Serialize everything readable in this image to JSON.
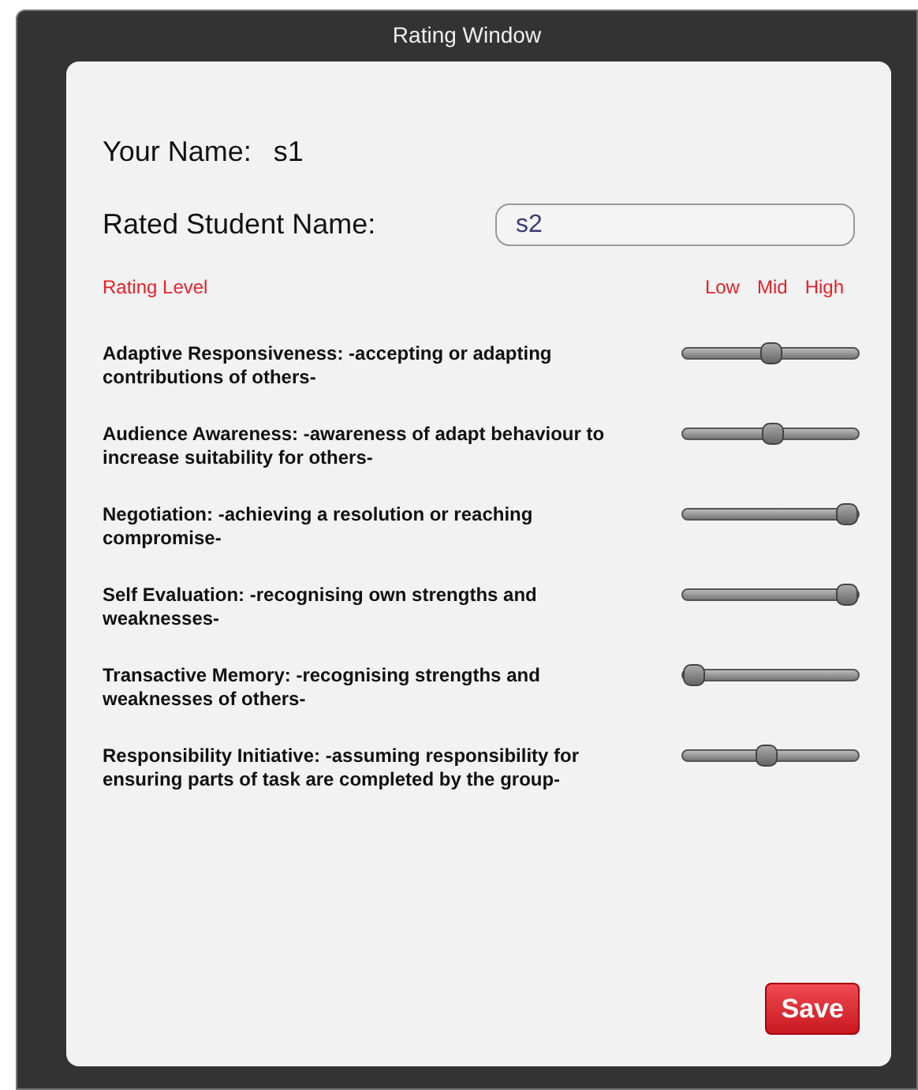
{
  "window": {
    "title": "Rating Window"
  },
  "your_name": {
    "label": "Your Name:",
    "value": "s1"
  },
  "rated_student": {
    "label": "Rated Student Name:",
    "value": "s2"
  },
  "scale": {
    "title": "Rating Level",
    "labels": [
      "Low",
      "Mid",
      "High"
    ]
  },
  "criteria": [
    {
      "text": "Adaptive Responsiveness: -accepting or adapting contributions of others-",
      "level": 0.5
    },
    {
      "text": "Audience Awareness: -awareness of adapt behaviour to increase suitability for others-",
      "level": 0.52
    },
    {
      "text": "Negotiation: -achieving a resolution or reaching compromise-",
      "level": 1
    },
    {
      "text": "Self Evaluation: -recognising own strengths and weaknesses-",
      "level": 1
    },
    {
      "text": "Transactive Memory: -recognising strengths and weaknesses of others-",
      "level": 0
    },
    {
      "text": "Responsibility Initiative: -assuming responsibility for ensuring parts of task are completed by the group-",
      "level": 0.47
    }
  ],
  "buttons": [
    "Save"
  ]
}
